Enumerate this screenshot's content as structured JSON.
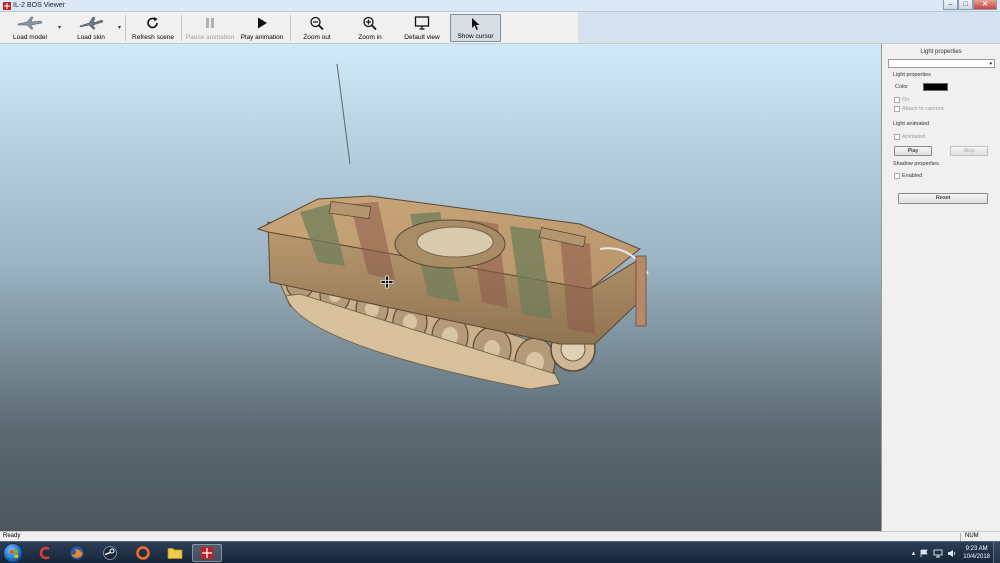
{
  "window": {
    "title": "IL-2 BOS Viewer",
    "minimize": "–",
    "maximize": "□",
    "close": "✕"
  },
  "toolbar": {
    "load_model": "Load model",
    "load_skin": "Load skin",
    "refresh_scene": "Refresh scene",
    "pause_animation": "Pause animation",
    "play_animation": "Play animation",
    "zoom_out": "Zoom out",
    "zoom_in": "Zoom in",
    "default_view": "Default view",
    "show_cursor": "Show cursor",
    "dropdown_glyph": "▾"
  },
  "panel": {
    "title": "Light properties",
    "combo_value": "",
    "combo_arrow": "▾",
    "light_properties": {
      "heading": "Light properties",
      "color_label": "Color",
      "color_value": "#000000",
      "on_label": "On",
      "attach_label": "Attach to camera"
    },
    "light_animated": {
      "heading": "Light animated",
      "animated_label": "Animated",
      "play_label": "Play",
      "stop_label": "Stop"
    },
    "shadow_properties": {
      "heading": "Shadow properties",
      "enabled_label": "Enabled"
    },
    "reset_label": "Reset"
  },
  "statusbar": {
    "ready": "Ready",
    "num": "NUM"
  },
  "taskbar": {
    "time": "9:23 AM",
    "date": "10/4/2018",
    "tray_arrow": "▴"
  },
  "colors": {
    "accent_close": "#c7443a",
    "viewport_top": "#cfe9f7",
    "viewport_bottom": "#4c575d",
    "taskbar": "#17263a"
  }
}
